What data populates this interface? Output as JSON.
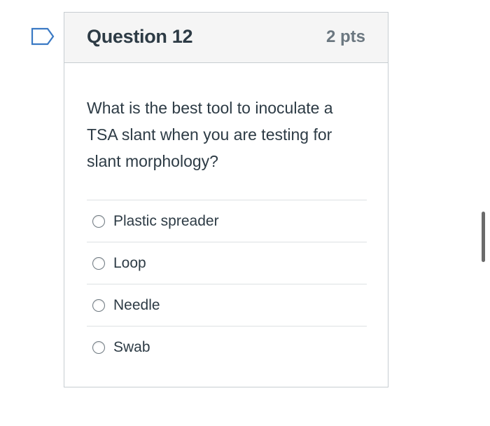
{
  "question": {
    "title": "Question 12",
    "points": "2 pts",
    "text": "What is the best tool to inoculate a TSA slant when you are testing for slant morphology?",
    "answers": [
      {
        "label": "Plastic spreader",
        "selected": false
      },
      {
        "label": "Loop",
        "selected": false
      },
      {
        "label": "Needle",
        "selected": false
      },
      {
        "label": "Swab",
        "selected": false
      }
    ]
  },
  "icons": {
    "flag": "flag-outline-icon"
  },
  "colors": {
    "flag_stroke": "#3a79c4",
    "header_bg": "#f5f5f5",
    "border": "#c7cdd1",
    "text": "#2d3b45",
    "points_text": "#6b7780"
  }
}
